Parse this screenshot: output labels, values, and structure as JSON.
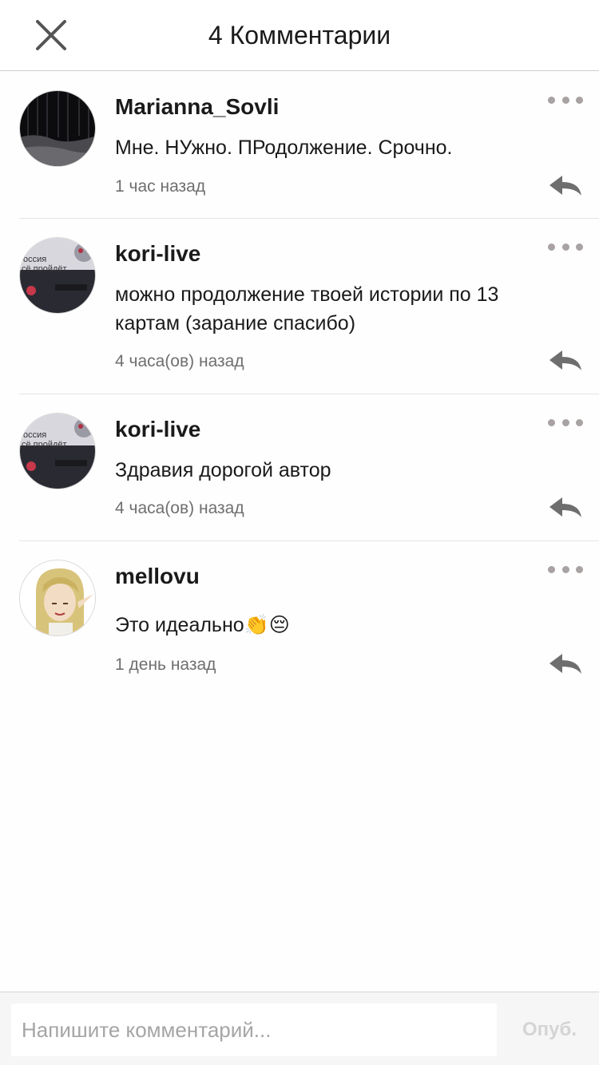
{
  "header": {
    "title": "4 Комментарии",
    "close_icon": "close-icon"
  },
  "comments": [
    {
      "username": "Marianna_Sovli",
      "text": "Мне. НУжно. ПРодолжение. Срочно.",
      "time": "1 час назад"
    },
    {
      "username": "kori-live",
      "text": "можно продолжение твоей истории по 13 картам (зарание спасибо)",
      "time": "4 часа(ов) назад",
      "avatar_text": [
        "оссия",
        "сё пройдёт"
      ]
    },
    {
      "username": "kori-live",
      "text": "Здравия дорогой автор",
      "time": "4 часа(ов) назад",
      "avatar_text": [
        "оссия",
        "сё пройдёт"
      ]
    },
    {
      "username": "mellovu",
      "text": "Это идеально👏😔",
      "time": "1 день назад"
    }
  ],
  "composer": {
    "placeholder": "Напишите комментарий...",
    "publish_label": "Опуб."
  },
  "colors": {
    "more_dots": "#a8a2a2",
    "reply_icon": "#6e6e6e",
    "divider": "#e4e4e4"
  },
  "icons": {
    "more": "more-dots-icon",
    "reply": "reply-arrow-icon"
  }
}
